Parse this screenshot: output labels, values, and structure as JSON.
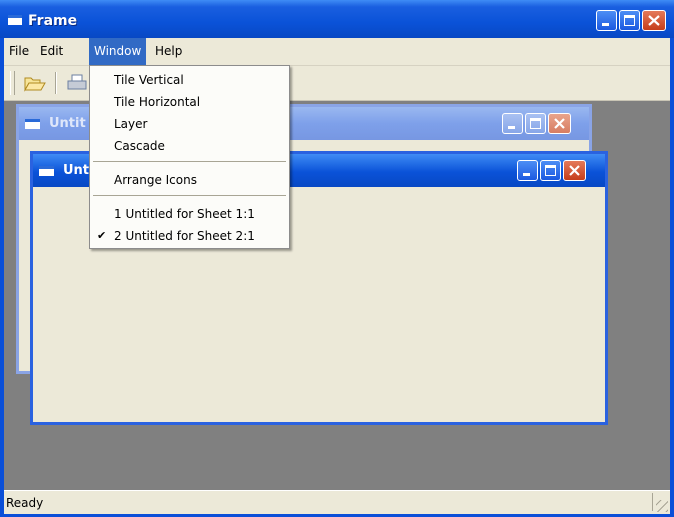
{
  "window": {
    "title": "Frame"
  },
  "menubar": [
    "File",
    "Edit",
    "Window",
    "Help"
  ],
  "window_menu": {
    "items": [
      "Tile Vertical",
      "Tile Horizontal",
      "Layer",
      "Cascade",
      "Arrange Icons",
      "1 Untitled for Sheet 1:1",
      "2 Untitled for Sheet 2:1"
    ],
    "checked_item": "2 Untitled for Sheet 2:1",
    "check_mark": "✔"
  },
  "inner_windows": [
    {
      "title": "Untitled for Sheet 1:1",
      "visible_title": "Untit",
      "state": "inactive"
    },
    {
      "title": "Untitled for Sheet 2:1",
      "visible_title": "Unt",
      "state": "active"
    }
  ],
  "status": {
    "text": "Ready"
  },
  "colors": {
    "titlebar": "#0a52d8",
    "menu_highlight": "#316ac5",
    "desktop": "#808080",
    "close_button": "#c63d1a"
  }
}
